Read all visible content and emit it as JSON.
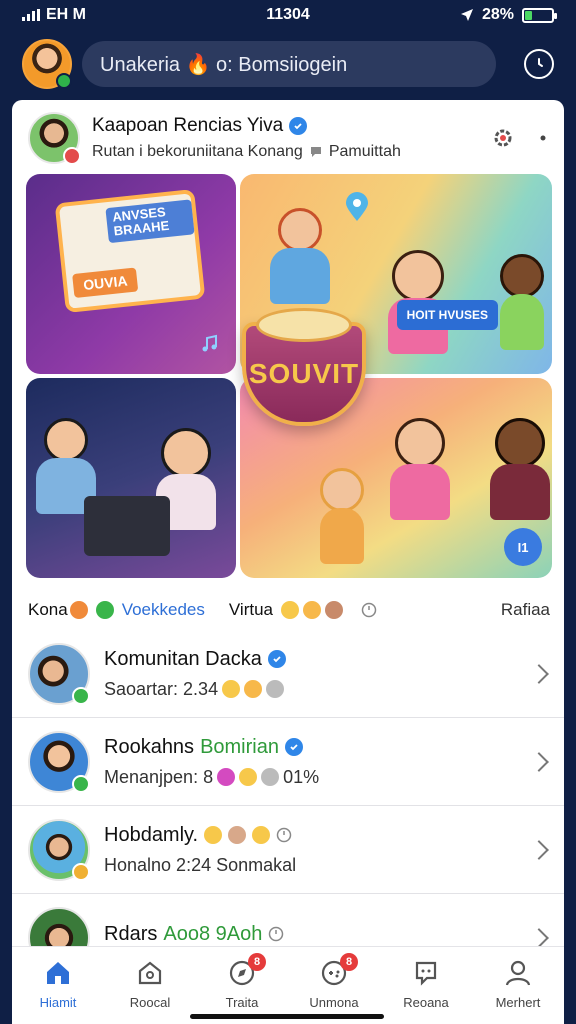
{
  "status_bar": {
    "carrier": "EH M",
    "time": "11304",
    "battery": "28%",
    "battery_level": 0.28
  },
  "header": {
    "search_text": "Unakeria 🔥 o: Bomsiiogein",
    "action_icon": "clock-icon"
  },
  "post": {
    "author": "Kaapoan Rencias Yiva",
    "subtitle": "Rutan i bekoruniitana Konang",
    "subtitle_tail": "Pamuittah",
    "collage": {
      "card_label": "ANVSES BRAAHE",
      "card_button": "OUVIA",
      "bowl_label": "SOUVIT",
      "sign_label": "HOIT HVUSES",
      "play_label": "I1"
    }
  },
  "tags": {
    "first": "Kona",
    "second": "Voekkedes",
    "third": "Virtua",
    "right": "Rafiaa"
  },
  "list": [
    {
      "title": "Komunitan Dacka",
      "verified": true,
      "sub": "Saoartar: 2.34"
    },
    {
      "title": "Rookahns",
      "title_green": "Bomirian",
      "verified": true,
      "sub": "Menanjpen: 8",
      "sub_tail": "01%"
    },
    {
      "title": "Hobdamly.",
      "verified": false,
      "sub": "Honalno 2:24 Sonmakal"
    },
    {
      "title": "Rdars",
      "title_green": "Aoo8 9Aoh",
      "verified": false,
      "sub": ""
    }
  ],
  "nav": [
    {
      "label": "Hiamit",
      "icon": "home-icon",
      "active": true
    },
    {
      "label": "Roocal",
      "icon": "house-outline-icon",
      "active": false
    },
    {
      "label": "Traita",
      "icon": "compass-icon",
      "active": false,
      "badge": "8"
    },
    {
      "label": "Unmona",
      "icon": "game-controller-icon",
      "active": false,
      "badge": "8"
    },
    {
      "label": "Reoana",
      "icon": "message-icon",
      "active": false
    },
    {
      "label": "Merhert",
      "icon": "profile-icon",
      "active": false
    }
  ],
  "colors": {
    "background": "#0f1f45",
    "accent": "#2e6fd6",
    "verified": "#2f86e8",
    "badge_red": "#e53b3b",
    "online_green": "#39b54a"
  }
}
